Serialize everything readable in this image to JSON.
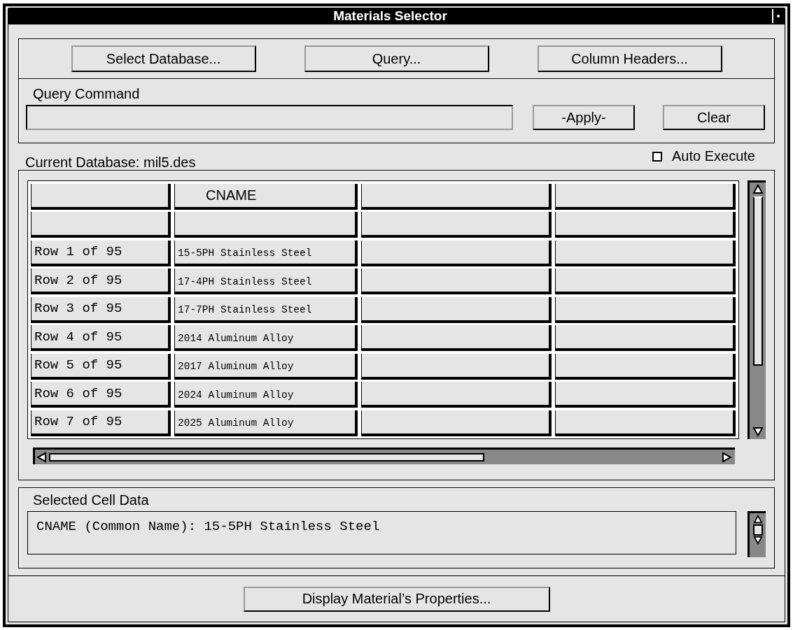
{
  "window": {
    "title": "Materials Selector"
  },
  "toolbar": {
    "buttons": [
      "Select Database...",
      "Query...",
      "Column Headers..."
    ]
  },
  "query": {
    "label": "Query Command",
    "buttons": [
      "-Apply-",
      "Clear"
    ]
  },
  "current_database": "Current Database: mil5.des",
  "auto_execute": {
    "label": "Auto Execute",
    "checked": false
  },
  "table": {
    "columns": [
      {
        "kind": "blank"
      },
      {
        "kind": "header",
        "label": "CNAME"
      },
      {
        "kind": "blank"
      },
      {
        "kind": "blank"
      }
    ],
    "rows": [
      {
        "kind": "blank"
      },
      {
        "kind": "data",
        "label": "Row 1 of 95",
        "cells": [
          "15-5PH Stainless Steel"
        ]
      },
      {
        "kind": "data",
        "label": "Row 2 of 95",
        "cells": [
          "17-4PH Stainless Steel"
        ]
      },
      {
        "kind": "data",
        "label": "Row 3 of 95",
        "cells": [
          "17-7PH Stainless Steel"
        ]
      },
      {
        "kind": "data",
        "label": "Row 4 of 95",
        "cells": [
          "2014 Aluminum Alloy"
        ]
      },
      {
        "kind": "data",
        "label": "Row 5 of 95",
        "cells": [
          "2017 Aluminum Alloy"
        ]
      },
      {
        "kind": "data",
        "label": "Row 6 of 95",
        "cells": [
          "2024 Aluminum Alloy"
        ]
      },
      {
        "kind": "data",
        "label": "Row 7 of 95",
        "cells": [
          "2025 Aluminum Alloy"
        ]
      }
    ]
  },
  "selected_cell": {
    "label": "Selected Cell Data",
    "text": "CNAME (Common Name): 15-5PH Stainless Steel"
  },
  "footer": {
    "button": "Display Material’s Properties..."
  }
}
